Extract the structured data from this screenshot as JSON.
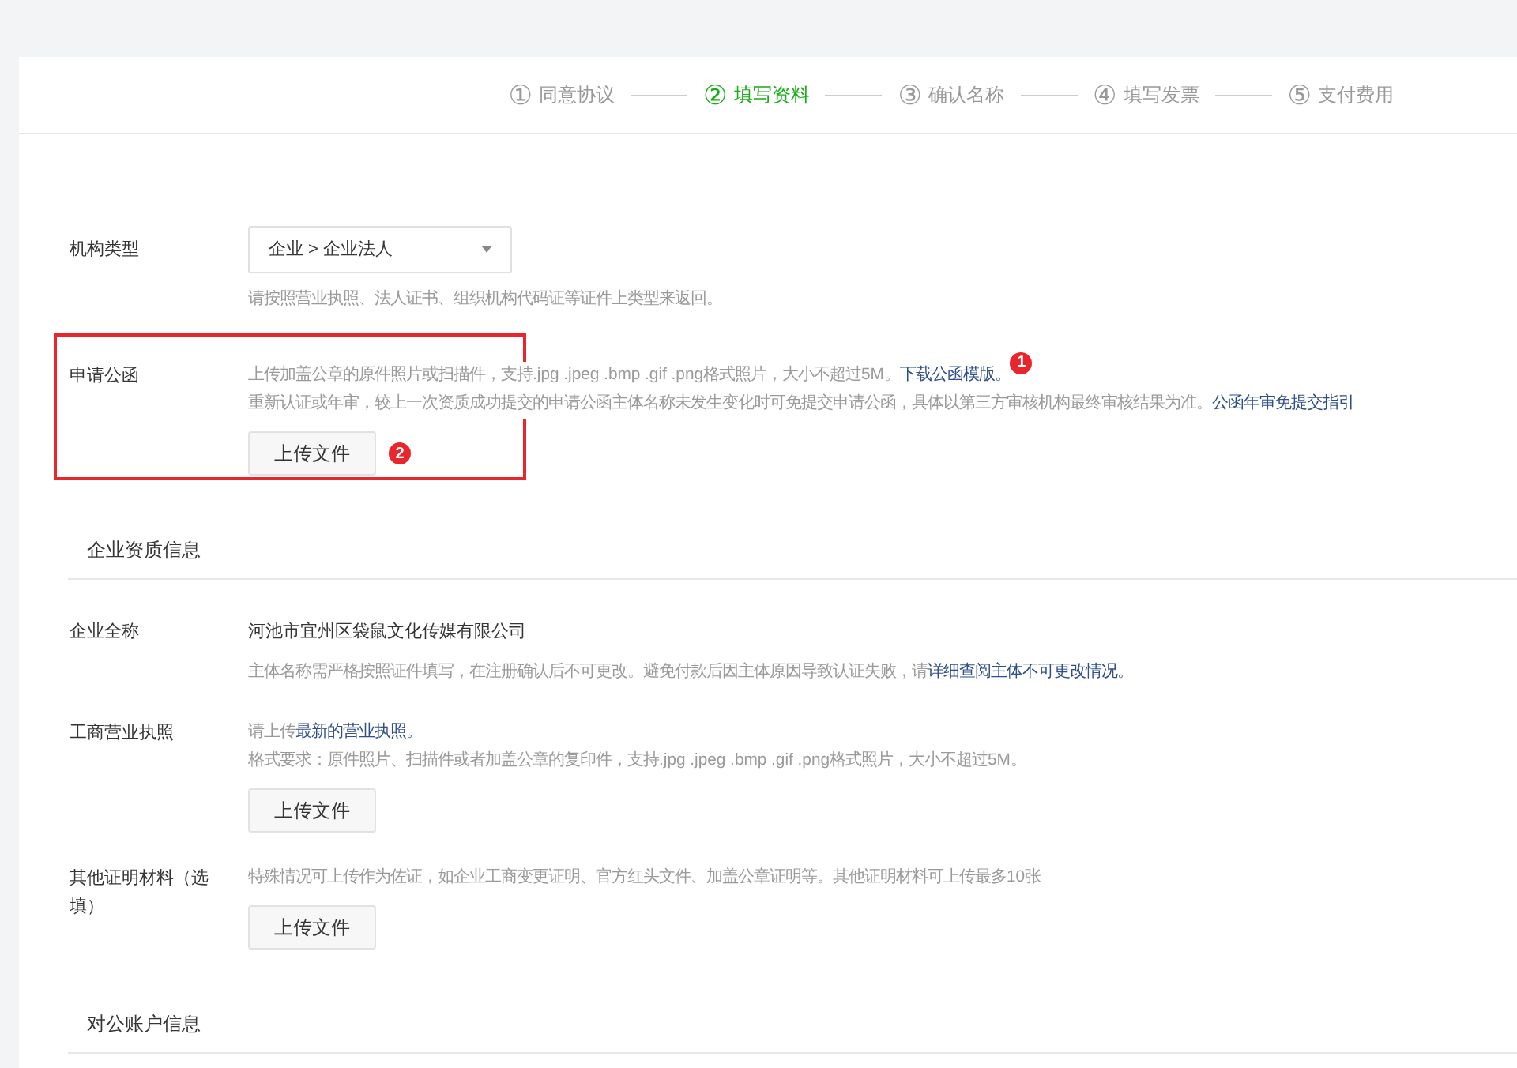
{
  "steps": [
    {
      "number": "①",
      "label": "同意协议",
      "selected": false
    },
    {
      "number": "②",
      "label": "填写资料",
      "selected": true
    },
    {
      "number": "③",
      "label": "确认名称",
      "selected": false
    },
    {
      "number": "④",
      "label": "填写发票",
      "selected": false
    },
    {
      "number": "⑤",
      "label": "支付费用",
      "selected": false
    }
  ],
  "sections": [
    {
      "kind": "fields",
      "fields": [
        {
          "label": "机构类型",
          "highlighted": false,
          "select": "企业 > 企业法人",
          "lines": [
            [
              {
                "text": "请按照营业执照、法人证书、组织机构代码证等证件上类型来返回。",
                "link": false
              }
            ]
          ]
        },
        {
          "label": "申请公函",
          "highlighted": true,
          "lines": [
            [
              {
                "text": "上传加盖公章的原件照片或扫描件，支持.jpg .jpeg .bmp .gif .png格式照片，大小不超过5M。",
                "link": false
              },
              {
                "text": "下载公函模版。",
                "link": true
              },
              {
                "badge": "1"
              }
            ],
            [
              {
                "text": "重新认证或年审，较上一次资质成功提交的申请公函主体名称未发生变化时可免提交申请公函，具体以第三方审核机构最终审核结果为准。",
                "link": false
              },
              {
                "text": "公函年审免提交指引",
                "link": true
              }
            ]
          ],
          "button": "上传文件",
          "button_badge": "2"
        }
      ]
    },
    {
      "kind": "heading",
      "title": "企业资质信息"
    },
    {
      "kind": "fields",
      "fields": [
        {
          "label": "企业全称",
          "highlighted": false,
          "value": "河池市宜州区袋鼠文化传媒有限公司",
          "lines": [
            [
              {
                "text": "主体名称需严格按照证件填写，在注册确认后不可更改。避免付款后因主体原因导致认证失败，请",
                "link": false
              },
              {
                "text": "详细查阅主体不可更改情况。",
                "link": true
              }
            ]
          ]
        },
        {
          "label": "工商营业执照",
          "highlighted": false,
          "lines": [
            [
              {
                "text": "请上传",
                "link": false
              },
              {
                "text": "最新的营业执照。",
                "link": true
              }
            ],
            [
              {
                "text": "格式要求：原件照片、扫描件或者加盖公章的复印件，支持.jpg .jpeg .bmp .gif .png格式照片，大小不超过5M。",
                "link": false
              }
            ]
          ],
          "button": "上传文件"
        },
        {
          "label": "其他证明材料（选填）",
          "highlighted": false,
          "lines": [
            [
              {
                "text": "特殊情况可上传作为佐证，如企业工商变更证明、官方红头文件、加盖公章证明等。其他证明材料可上传最多10张",
                "link": false
              }
            ]
          ],
          "button": "上传文件"
        }
      ]
    },
    {
      "kind": "heading",
      "title": "对公账户信息"
    }
  ]
}
